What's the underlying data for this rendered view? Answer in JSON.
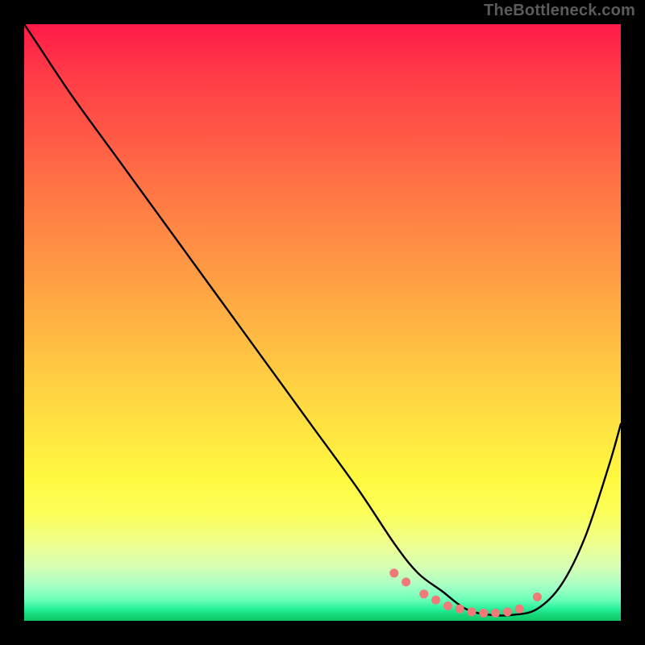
{
  "attribution": "TheBottleneck.com",
  "chart_data": {
    "type": "line",
    "title": "",
    "xlabel": "",
    "ylabel": "",
    "xlim": [
      0,
      100
    ],
    "ylim": [
      0,
      100
    ],
    "series": [
      {
        "name": "bottleneck-curve",
        "x": [
          0,
          2,
          8,
          16,
          24,
          32,
          40,
          48,
          56,
          62,
          66,
          70,
          74,
          78,
          82,
          86,
          90,
          94,
          98,
          100
        ],
        "y": [
          100,
          97,
          88,
          77,
          66,
          55,
          44,
          33,
          22,
          13,
          8,
          5,
          2,
          1,
          1,
          2,
          6,
          14,
          26,
          33
        ]
      }
    ],
    "markers": {
      "name": "highlight-dots",
      "x": [
        62,
        64,
        67,
        69,
        71,
        73,
        75,
        77,
        79,
        81,
        83,
        86
      ],
      "y": [
        8,
        6.5,
        4.5,
        3.5,
        2.5,
        2,
        1.5,
        1.3,
        1.3,
        1.5,
        2,
        4
      ]
    },
    "background": {
      "type": "vertical-gradient",
      "stops": [
        {
          "pos": 0,
          "color": "#ff1a47"
        },
        {
          "pos": 50,
          "color": "#ffca42"
        },
        {
          "pos": 80,
          "color": "#fff940"
        },
        {
          "pos": 100,
          "color": "#0fc564"
        }
      ]
    }
  }
}
